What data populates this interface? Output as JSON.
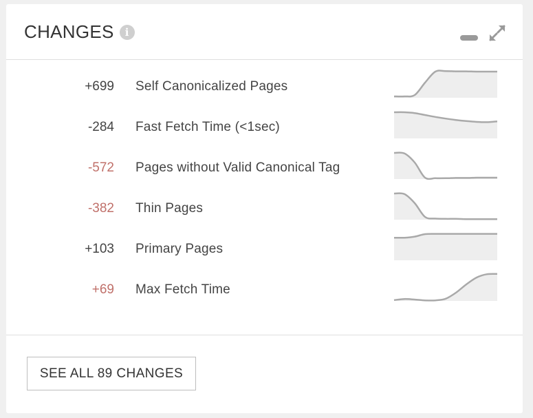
{
  "widget": {
    "title": "CHANGES",
    "info_icon": "info-icon",
    "minimize_icon": "minimize-icon",
    "expand_icon": "expand-icon"
  },
  "changes": [
    {
      "delta": "+699",
      "label": "Self Canonicalized Pages",
      "negative": false,
      "trend": [
        0.05,
        0.05,
        0.1,
        0.55,
        0.95,
        0.97,
        0.96,
        0.96,
        0.95,
        0.95,
        0.95
      ]
    },
    {
      "delta": "-284",
      "label": "Fast Fetch Time (<1sec)",
      "negative": false,
      "trend": [
        0.95,
        0.95,
        0.92,
        0.85,
        0.78,
        0.72,
        0.67,
        0.63,
        0.6,
        0.59,
        0.62
      ]
    },
    {
      "delta": "-572",
      "label": "Pages without Valid Canonical Tag",
      "negative": true,
      "trend": [
        0.95,
        0.93,
        0.6,
        0.05,
        0.03,
        0.03,
        0.04,
        0.04,
        0.05,
        0.05,
        0.05
      ]
    },
    {
      "delta": "-382",
      "label": "Thin Pages",
      "negative": true,
      "trend": [
        0.95,
        0.93,
        0.6,
        0.1,
        0.04,
        0.03,
        0.03,
        0.02,
        0.02,
        0.02,
        0.02
      ]
    },
    {
      "delta": "+103",
      "label": "Primary Pages",
      "negative": false,
      "trend": [
        0.82,
        0.82,
        0.86,
        0.95,
        0.96,
        0.96,
        0.96,
        0.96,
        0.96,
        0.96,
        0.96
      ]
    },
    {
      "delta": "+69",
      "label": "Max Fetch Time",
      "negative": true,
      "trend": [
        0.03,
        0.07,
        0.05,
        0.02,
        0.02,
        0.08,
        0.3,
        0.6,
        0.85,
        0.97,
        0.98
      ]
    }
  ],
  "footer": {
    "button_label": "SEE ALL 89 CHANGES"
  },
  "colors": {
    "negative_delta": "#c0706a",
    "spark_fill": "#eeeeee",
    "spark_line": "#a9a9a9"
  }
}
